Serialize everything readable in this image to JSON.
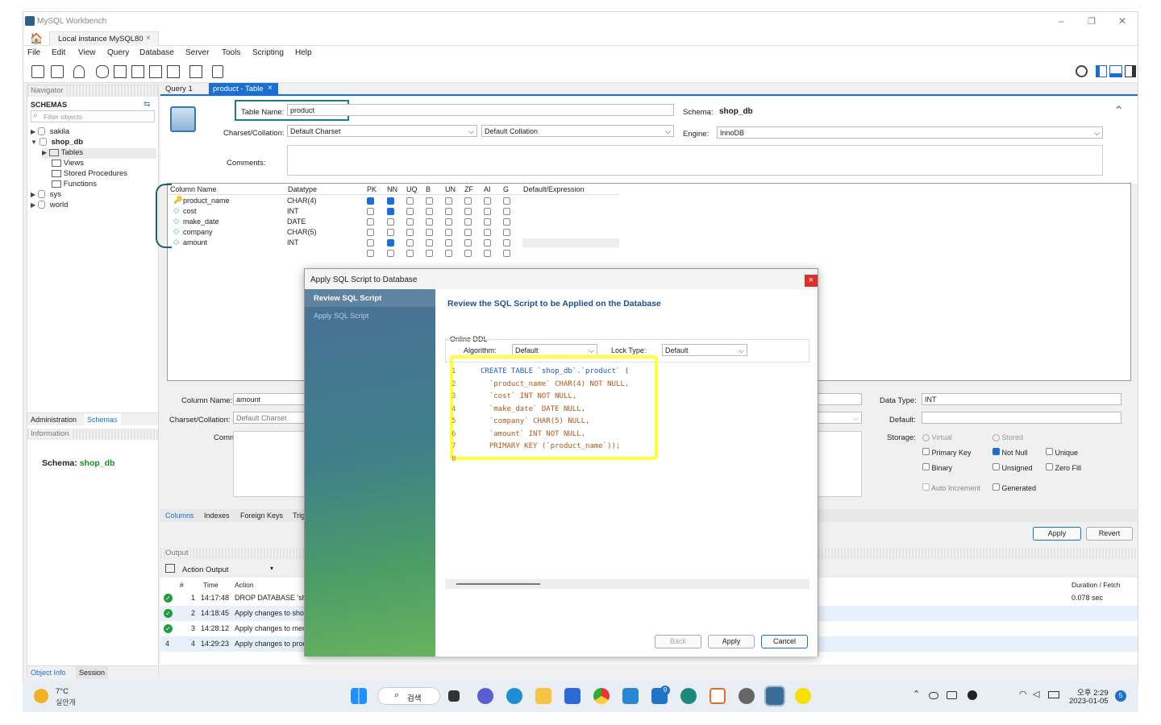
{
  "app": {
    "title": "MySQL Workbench",
    "tab_label": "Local instance MySQL80",
    "tab_close": "×",
    "win_min": "–",
    "win_max": "❐",
    "win_close": "✕"
  },
  "menu": [
    "File",
    "Edit",
    "View",
    "Query",
    "Database",
    "Server",
    "Tools",
    "Scripting",
    "Help"
  ],
  "navigator": {
    "header": "Navigator",
    "schemas_label": "SCHEMAS",
    "filter_placeholder": "Filter objects",
    "tree": [
      {
        "label": "sakila"
      },
      {
        "label": "shop_db"
      },
      {
        "label": "Tables"
      },
      {
        "label": "Views"
      },
      {
        "label": "Stored Procedures"
      },
      {
        "label": "Functions"
      },
      {
        "label": "sys"
      },
      {
        "label": "world"
      }
    ],
    "tab_admin": "Administration",
    "tab_schemas": "Schemas",
    "info_header": "Information",
    "schema_label": "Schema:",
    "schema_value": "shop_db",
    "tab_object_info": "Object Info",
    "tab_session": "Session"
  },
  "editor_tabs": {
    "query": "Query 1",
    "product": "product - Table",
    "close": "×"
  },
  "table_editor": {
    "table_name_label": "Table Name:",
    "table_name": "product",
    "schema_label": "Schema:",
    "schema_value": "shop_db",
    "charset_label": "Charset/Collation:",
    "charset": "Default Charset",
    "collation": "Default Collation",
    "engine_label": "Engine:",
    "engine": "InnoDB",
    "comments_label": "Comments:"
  },
  "columns_grid": {
    "headers": [
      "Column Name",
      "Datatype",
      "PK",
      "NN",
      "UQ",
      "B",
      "UN",
      "ZF",
      "AI",
      "G",
      "Default/Expression"
    ],
    "rows": [
      {
        "name": "product_name",
        "type": "CHAR(4)",
        "flags": [
          1,
          1,
          0,
          0,
          0,
          0,
          0,
          0
        ]
      },
      {
        "name": "cost",
        "type": "INT",
        "flags": [
          0,
          1,
          0,
          0,
          0,
          0,
          0,
          0
        ]
      },
      {
        "name": "make_date",
        "type": "DATE",
        "flags": [
          0,
          0,
          0,
          0,
          0,
          0,
          0,
          0
        ]
      },
      {
        "name": "company",
        "type": "CHAR(5)",
        "flags": [
          0,
          0,
          0,
          0,
          0,
          0,
          0,
          0
        ]
      },
      {
        "name": "amount",
        "type": "INT",
        "flags": [
          0,
          1,
          0,
          0,
          0,
          0,
          0,
          0
        ]
      }
    ]
  },
  "column_detail": {
    "name_label": "Column Name:",
    "name": "amount",
    "charset_label": "Charset/Collation:",
    "charset": "Default Charset",
    "comments_label": "Comments:",
    "datatype_label": "Data Type:",
    "datatype": "INT",
    "default_label": "Default:",
    "storage_label": "Storage:",
    "virtual": "Virtual",
    "stored": "Stored",
    "primary_key": "Primary Key",
    "not_null": "Not Null",
    "unique": "Unique",
    "binary": "Binary",
    "unsigned": "Unsigned",
    "zero_fill": "Zero Fill",
    "auto_increment": "Auto Increment",
    "generated": "Generated"
  },
  "bottom_tabs": [
    "Columns",
    "Indexes",
    "Foreign Keys",
    "Trig"
  ],
  "apply_label": "Apply",
  "revert_label": "Revert",
  "output": {
    "header": "Output",
    "selector": "Action Output",
    "col_num": "#",
    "col_time": "Time",
    "col_action": "Action",
    "col_duration": "Duration / Fetch",
    "rows": [
      {
        "num": "1",
        "time": "14:17:48",
        "action": "DROP DATABASE 'sh",
        "duration": "0.078 sec"
      },
      {
        "num": "2",
        "time": "14:18:45",
        "action": "Apply changes to shop",
        "duration": ""
      },
      {
        "num": "3",
        "time": "14:28:12",
        "action": "Apply changes to mem",
        "duration": ""
      },
      {
        "num": "4",
        "time": "14:29:23",
        "action": "Apply changes to prod",
        "duration": ""
      }
    ],
    "row4_mark": "4"
  },
  "dialog": {
    "title": "Apply SQL Script to Database",
    "close": "×",
    "step1": "Review SQL Script",
    "step2": "Apply SQL Script",
    "heading": "Review the SQL Script to be Applied on the Database",
    "online_ddl": "Online DDL",
    "algorithm_label": "Algorithm:",
    "algorithm": "Default",
    "lock_label": "Lock Type:",
    "lock": "Default",
    "sql_lines": [
      "CREATE TABLE `shop_db`.`product` (",
      "  `product_name` CHAR(4) NOT NULL,",
      "  `cost` INT NOT NULL,",
      "  `make_date` DATE NULL,",
      "  `company` CHAR(5) NULL,",
      "  `amount` INT NOT NULL,",
      "  PRIMARY KEY (`product_name`));",
      ""
    ],
    "back": "Back",
    "apply": "Apply",
    "cancel": "Cancel"
  },
  "taskbar": {
    "temp": "7°C",
    "weather": "실안개",
    "search": "검색",
    "time": "오후 2:29",
    "date": "2023-01-05",
    "badge_mail": "9",
    "badge_notif": "5"
  },
  "colors": {
    "accent": "#1a6fd4",
    "highlight": "#ffff3c",
    "dialog_side": "#4a7fa0",
    "sql_keyword": "#1b5fcc"
  }
}
